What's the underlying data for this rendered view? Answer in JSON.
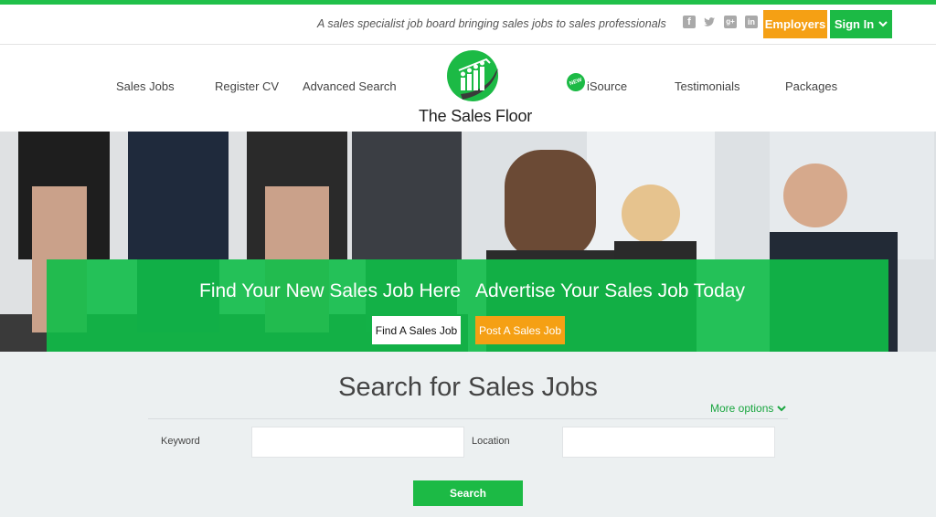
{
  "header": {
    "tagline": "A sales specialist job board bringing sales jobs to sales professionals",
    "social": [
      "facebook-icon",
      "twitter-icon",
      "google-plus-icon",
      "linkedin-icon"
    ],
    "employers_label": "Employers",
    "signin_label": "Sign In"
  },
  "nav": {
    "items": [
      {
        "label": "Sales Jobs"
      },
      {
        "label": "Register CV"
      },
      {
        "label": "Advanced Search"
      },
      {
        "label": "iSource",
        "badge": "NEW"
      },
      {
        "label": "Testimonials"
      },
      {
        "label": "Packages"
      }
    ],
    "logo_text": "The Sales Floor"
  },
  "hero": {
    "left_heading": "Find Your New Sales Job Here",
    "right_heading": "Advertise Your Sales Job Today",
    "find_button": "Find A Sales Job",
    "post_button": "Post A Sales Job"
  },
  "search": {
    "title": "Search for Sales Jobs",
    "more_options": "More options",
    "keyword_label": "Keyword",
    "keyword_value": "",
    "location_label": "Location",
    "location_value": "",
    "button": "Search"
  },
  "colors": {
    "brand_green": "#1cba45",
    "accent_orange": "#f5a014",
    "link_green": "#1aa640"
  }
}
